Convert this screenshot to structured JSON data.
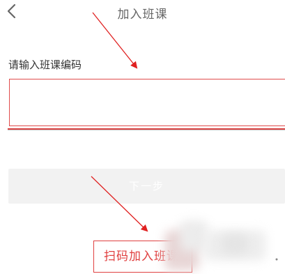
{
  "header": {
    "title": "加入班课",
    "back_icon": "chevron-left-icon"
  },
  "form": {
    "label": "请输入班课编码",
    "code_value": "",
    "next_button_label": "下一步"
  },
  "footer": {
    "scan_button_label": "扫码加入班课"
  },
  "colors": {
    "accent_red": "#e04040",
    "annotation_red": "#e02020",
    "disabled_button_bg": "#f2f2f2"
  }
}
